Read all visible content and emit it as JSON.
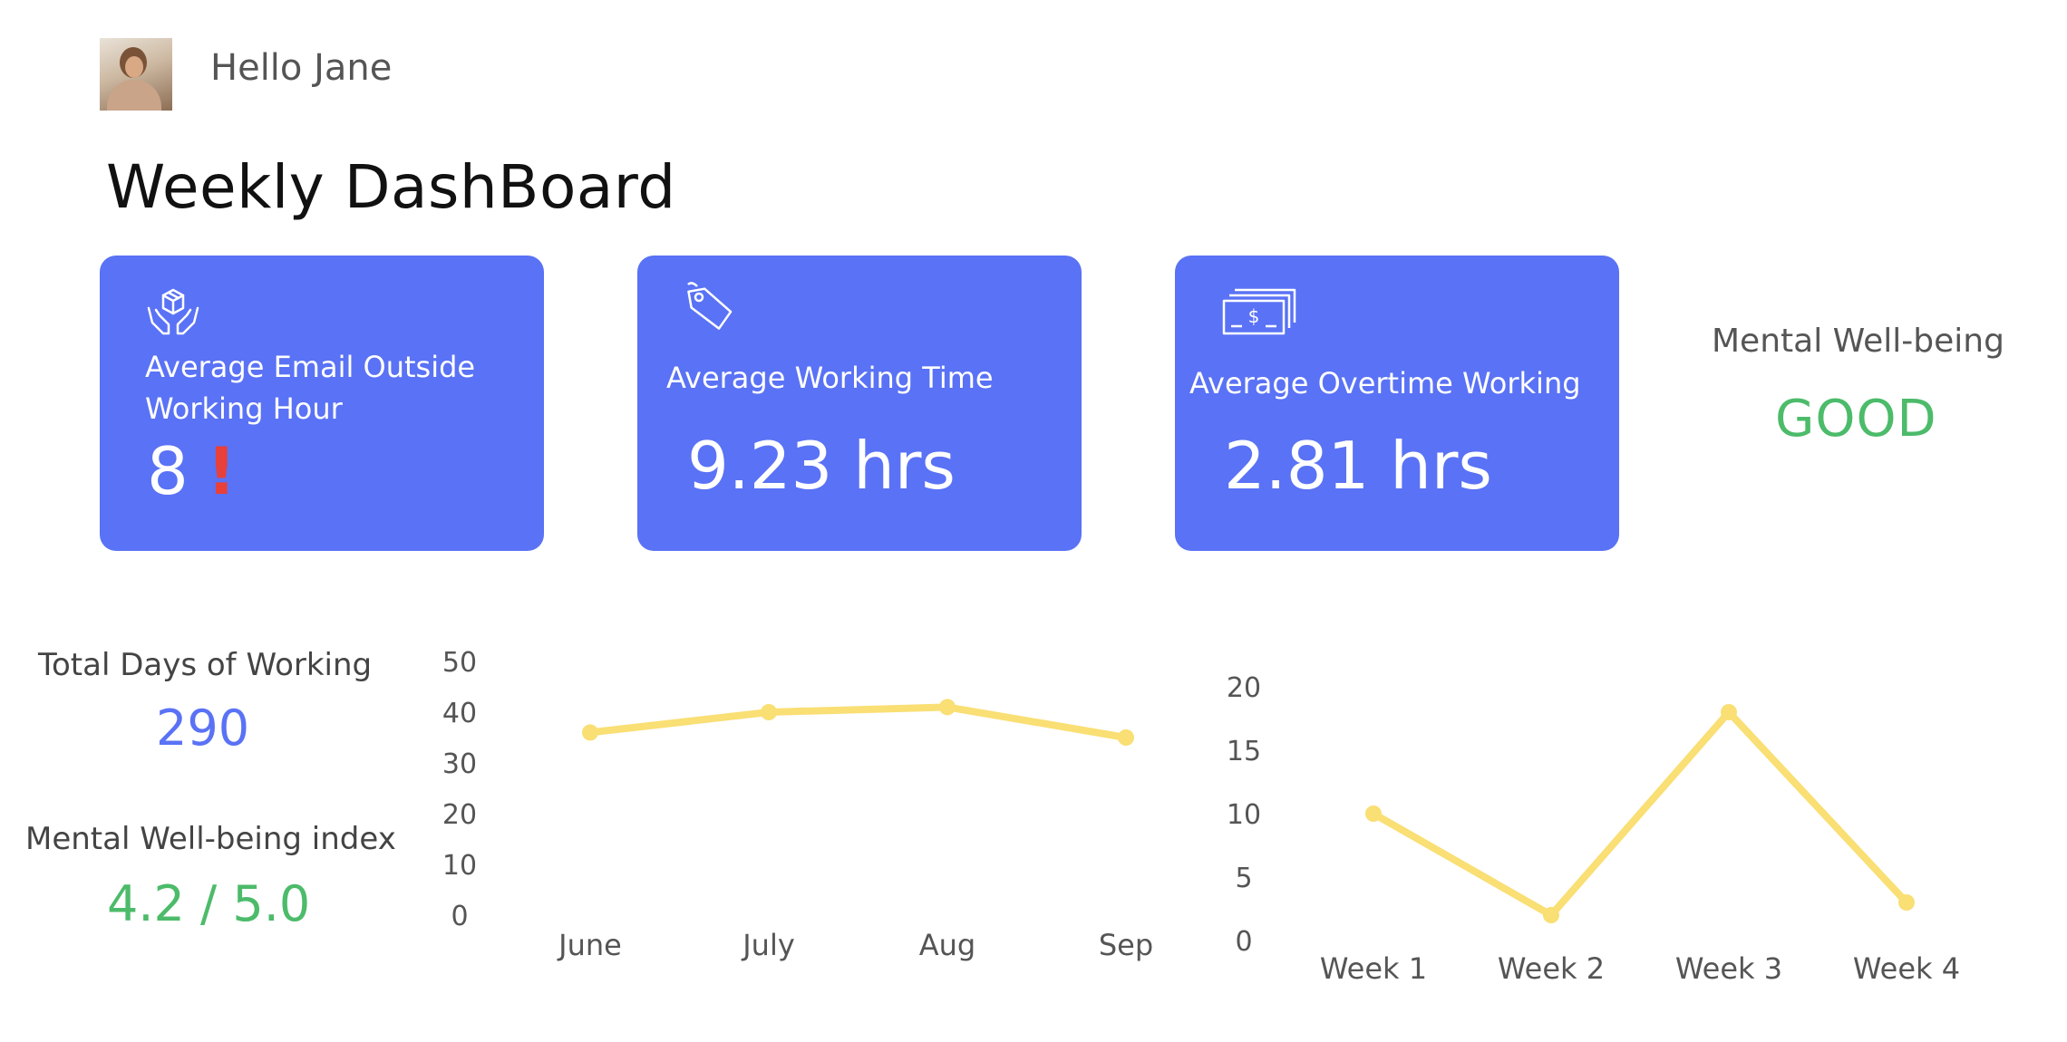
{
  "header": {
    "greeting": "Hello Jane",
    "avatar_icon": "user-avatar-photo"
  },
  "dashboard": {
    "title": "Weekly DashBoard"
  },
  "cards": [
    {
      "icon": "hands-box-icon",
      "label_line1": "Average Email Outside",
      "label_line2": "Working Hour",
      "value": "8",
      "alert": "!"
    },
    {
      "icon": "price-tag-icon",
      "label": "Average Working Time",
      "value": "9.23 hrs"
    },
    {
      "icon": "cash-stack-icon",
      "label": "Average Overtime Working",
      "value": "2.81 hrs"
    }
  ],
  "mental_wellbeing": {
    "label": "Mental Well-being",
    "value": "GOOD"
  },
  "stats": {
    "total_days_label": "Total Days of Working",
    "total_days_value": "290",
    "index_label": "Mental Well-being index",
    "index_value": "4.2 / 5.0"
  },
  "colors": {
    "card_blue": "#5a72f5",
    "good_green": "#4cbb6a",
    "alert_red": "#e8403a",
    "line_yellow": "#f9df74"
  },
  "chart_data": [
    {
      "type": "line",
      "categories": [
        "June",
        "July",
        "Aug",
        "Sep"
      ],
      "series": [
        {
          "values": [
            36,
            40,
            41,
            35
          ]
        }
      ],
      "yticks": [
        "0",
        "10",
        "20",
        "30",
        "40",
        "50"
      ],
      "ylim": [
        0,
        50
      ],
      "grid": false
    },
    {
      "type": "line",
      "categories": [
        "Week 1",
        "Week 2",
        "Week 3",
        "Week 4"
      ],
      "series": [
        {
          "values": [
            10,
            2,
            18,
            3
          ]
        }
      ],
      "yticks": [
        "0",
        "5",
        "10",
        "15",
        "20"
      ],
      "ylim": [
        0,
        20
      ],
      "grid": false
    }
  ]
}
